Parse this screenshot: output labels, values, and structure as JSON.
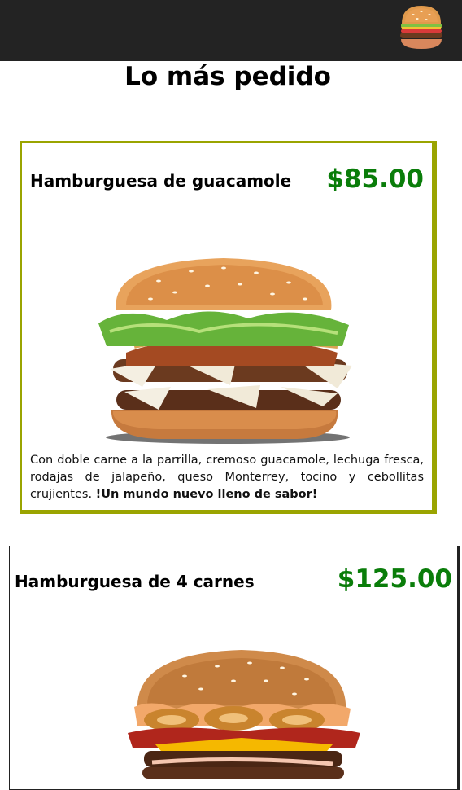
{
  "header": {
    "logo_icon": "burger-icon",
    "background_color": "#232323"
  },
  "page": {
    "title": "Lo más pedido"
  },
  "products": [
    {
      "name": "Hamburguesa de guacamole",
      "price": "$85.00",
      "image_icon": "guacamole-burger-image",
      "description": "Con doble carne a la parrilla, cremoso guacamole, lechuga fresca, rodajas de jalapeño, queso Monterrey, tocino y cebollitas crujientes.",
      "tagline": "!Un mundo nuevo lleno de sabor!",
      "border_color": "#9aa400"
    },
    {
      "name": "Hamburguesa de 4 carnes",
      "price": "$125.00",
      "image_icon": "four-meat-burger-image",
      "border_color": "#222222"
    }
  ],
  "colors": {
    "price": "#0a7d0a"
  }
}
